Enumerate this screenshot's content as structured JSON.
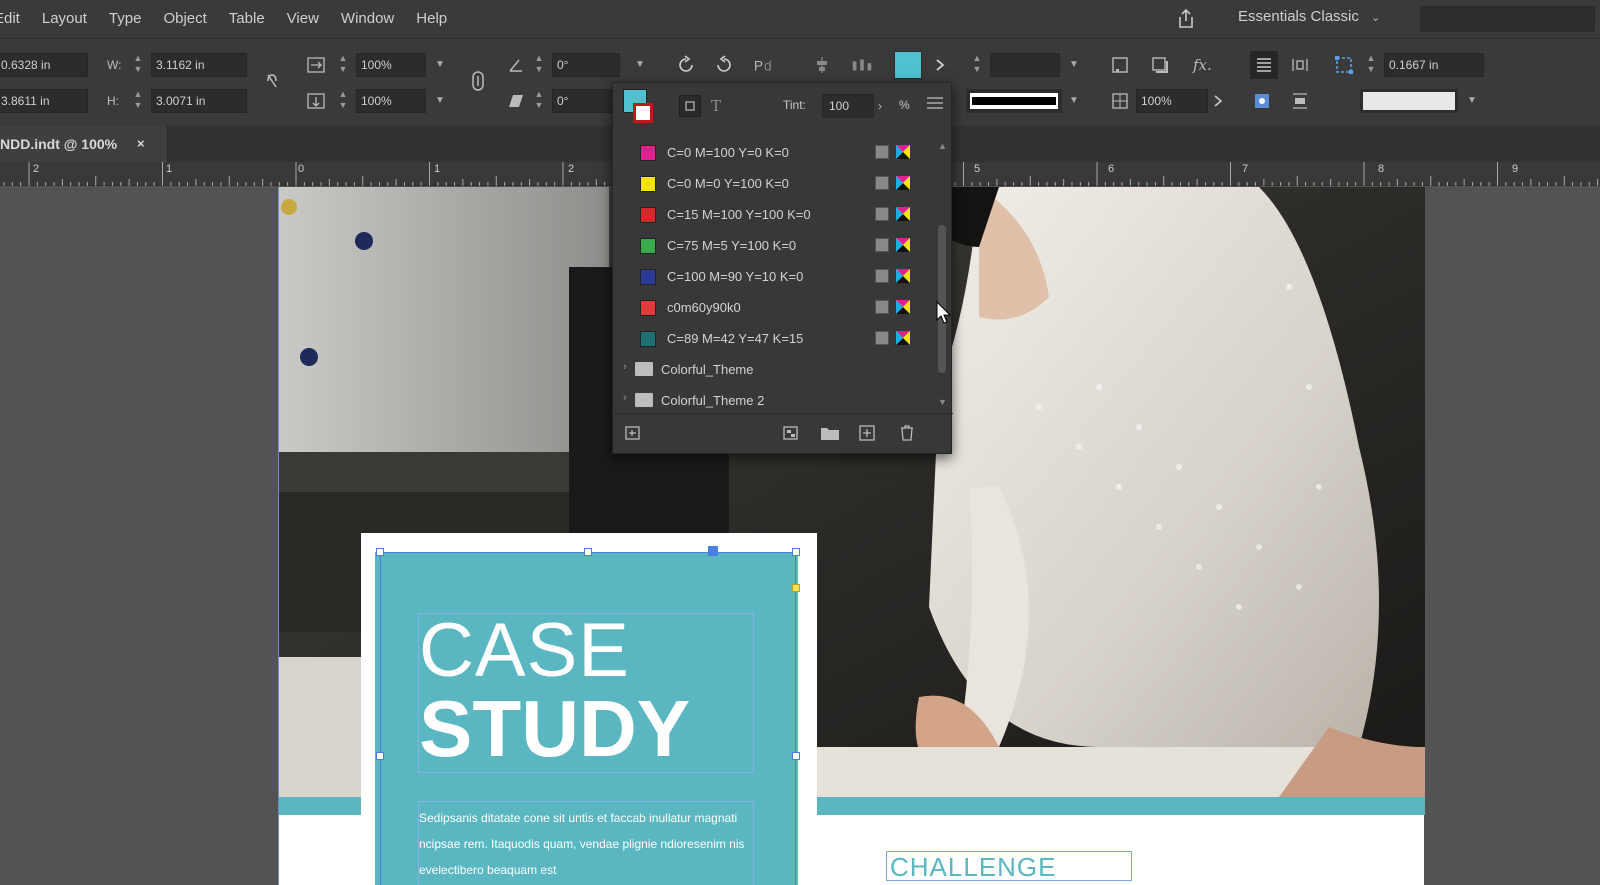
{
  "menu": [
    "Edit",
    "Layout",
    "Type",
    "Object",
    "Table",
    "View",
    "Window",
    "Help"
  ],
  "workspace": "Essentials Classic",
  "control": {
    "x": "0.6328 in",
    "y": "3.8611 in",
    "w_label": "W:",
    "w": "3.1162 in",
    "h_label": "H:",
    "h": "3.0071 in",
    "scale_x": "100%",
    "scale_y": "100%",
    "rotate": "0°",
    "shear": "0°",
    "opacity": "100%",
    "corner": "0.1667 in"
  },
  "doc_tab": "NDD.indt @ 100%",
  "doc_tab_close": "×",
  "ruler": [
    "2",
    "1",
    "0",
    "1",
    "2",
    "5",
    "6",
    "7",
    "8",
    "9"
  ],
  "swatches": {
    "tint_label": "Tint:",
    "tint": "100",
    "tint_unit": "%",
    "rows": [
      {
        "name": "C=0 M=100 Y=0 K=0",
        "color": "#e0208c"
      },
      {
        "name": "C=0 M=0 Y=100 K=0",
        "color": "#f4e600"
      },
      {
        "name": "C=15 M=100 Y=100 K=0",
        "color": "#d42a2a"
      },
      {
        "name": "C=75 M=5 Y=100 K=0",
        "color": "#3aaa4a"
      },
      {
        "name": "C=100 M=90 Y=10 K=0",
        "color": "#2b3a96"
      },
      {
        "name": "c0m60y90k0",
        "color": "#e03a3a"
      },
      {
        "name": "C=89 M=42 Y=47 K=15",
        "color": "#1f6e74"
      }
    ],
    "folders": [
      "Colorful_Theme",
      "Colorful_Theme 2"
    ]
  },
  "page": {
    "title_line1": "CASE",
    "title_line2": "STUDY",
    "body_text": "Sedipsanis ditatate cone sit untis et faccab inullatur magnati ncipsae rem. Itaquodis quam, vendae plignie ndioresenim nis evelectibero beaquam est",
    "challenge": "CHALLENGE"
  },
  "colors": {
    "accent_teal": "#5ab7c2",
    "selection_blue": "#4a7fe0"
  }
}
